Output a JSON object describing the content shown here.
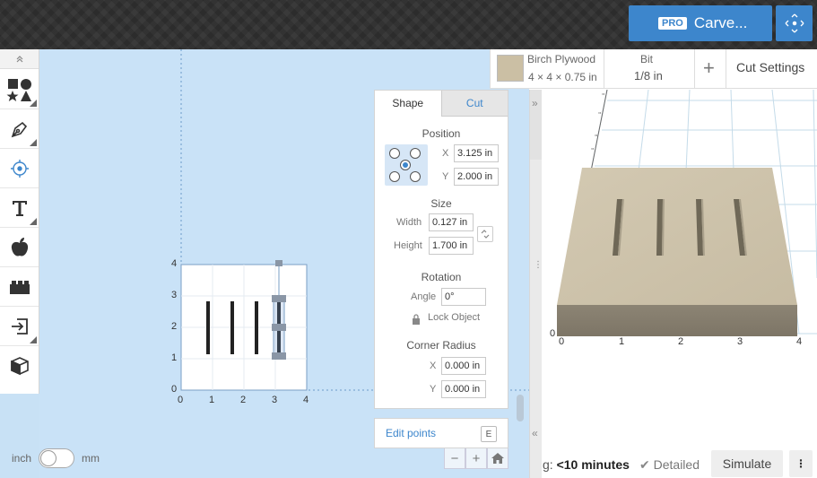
{
  "header": {
    "pro_badge": "PRO",
    "carve_label": "Carve...",
    "fullscreen_icon": "fullscreen-arrows-icon",
    "accent": "#3d86cc"
  },
  "toolbar": {
    "collapse_icon": "chevron-up-icon",
    "tools": [
      "shapes-icon",
      "pen-icon",
      "point-icon",
      "text-icon",
      "apple-icon",
      "lego-icon",
      "import-icon",
      "box-icon"
    ]
  },
  "canvas": {
    "x_ticks": [
      "0",
      "1",
      "2",
      "3",
      "4"
    ],
    "y_ticks": [
      "4",
      "3",
      "2",
      "1",
      "0"
    ]
  },
  "units": {
    "left": "inch",
    "right": "mm"
  },
  "zoom": {
    "minus": "−",
    "plus": "+",
    "home_icon": "home-icon"
  },
  "panel": {
    "tabs": [
      "Shape",
      "Cut"
    ],
    "position": {
      "title": "Position",
      "x_label": "X",
      "x_value": "3.125 in",
      "y_label": "Y",
      "y_value": "2.000 in"
    },
    "size": {
      "title": "Size",
      "width_label": "Width",
      "width_value": "0.127 in",
      "height_label": "Height",
      "height_value": "1.700 in"
    },
    "rotation": {
      "title": "Rotation",
      "angle_label": "Angle",
      "angle_value": "0°",
      "lock_label": "Lock Object"
    },
    "corner": {
      "title": "Corner Radius",
      "x_label": "X",
      "x_value": "0.000 in",
      "y_label": "Y",
      "y_value": "0.000 in"
    }
  },
  "edit_points": {
    "label": "Edit points",
    "key": "E"
  },
  "material": {
    "name": "Birch Plywood",
    "dims": "4 × 4 × 0.75 in",
    "bit_title": "Bit",
    "bit_value": "1/8 in",
    "add": "+",
    "cut_settings": "Cut Settings"
  },
  "preview": {
    "x_ticks": [
      "0",
      "1",
      "2",
      "3",
      "4"
    ],
    "y_zero": "0"
  },
  "footer": {
    "est_prefix": "g:",
    "est_value": "<10 minutes",
    "detailed": "Detailed",
    "simulate": "Simulate",
    "more": "⋮"
  }
}
